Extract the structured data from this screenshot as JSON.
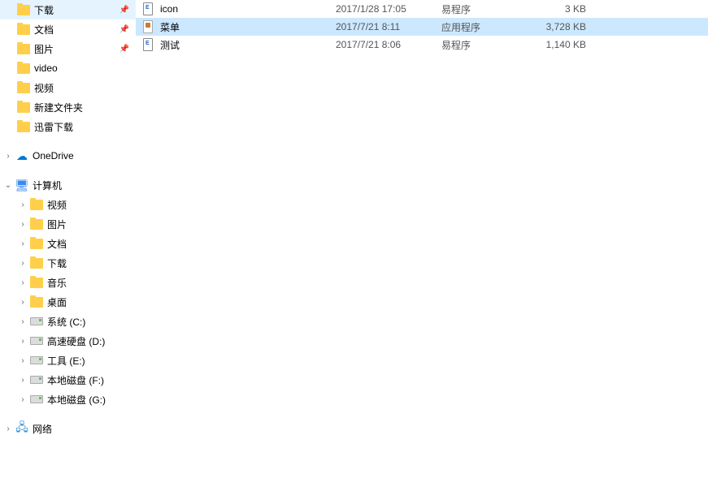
{
  "sidebar": {
    "quick": [
      {
        "label": "下载",
        "icon": "folder",
        "pinned": true
      },
      {
        "label": "文档",
        "icon": "folder",
        "pinned": true
      },
      {
        "label": "图片",
        "icon": "folder",
        "pinned": true
      },
      {
        "label": "video",
        "icon": "folder",
        "pinned": false
      },
      {
        "label": "视频",
        "icon": "folder",
        "pinned": false
      },
      {
        "label": "新建文件夹",
        "icon": "folder",
        "pinned": false
      },
      {
        "label": "迅雷下载",
        "icon": "folder",
        "pinned": false
      }
    ],
    "onedrive": {
      "label": "OneDrive",
      "chevron": ">"
    },
    "computer": {
      "label": "计算机",
      "chevron": "v",
      "items": [
        {
          "label": "视频",
          "icon": "folder"
        },
        {
          "label": "图片",
          "icon": "folder"
        },
        {
          "label": "文档",
          "icon": "folder"
        },
        {
          "label": "下载",
          "icon": "folder"
        },
        {
          "label": "音乐",
          "icon": "folder"
        },
        {
          "label": "桌面",
          "icon": "folder"
        },
        {
          "label": "系统 (C:)",
          "icon": "drive"
        },
        {
          "label": "高速硬盘 (D:)",
          "icon": "drive"
        },
        {
          "label": "工具 (E:)",
          "icon": "drive"
        },
        {
          "label": "本地磁盘 (F:)",
          "icon": "drive"
        },
        {
          "label": "本地磁盘 (G:)",
          "icon": "drive"
        }
      ]
    },
    "network": {
      "label": "网络",
      "chevron": ">"
    }
  },
  "files": [
    {
      "name": "icon",
      "date": "2017/1/28 17:05",
      "type": "易程序",
      "size": "3 KB",
      "icon": "doc",
      "selected": false
    },
    {
      "name": "菜单",
      "date": "2017/7/21 8:11",
      "type": "应用程序",
      "size": "3,728 KB",
      "icon": "exe",
      "selected": true
    },
    {
      "name": "测试",
      "date": "2017/7/21 8:06",
      "type": "易程序",
      "size": "1,140 KB",
      "icon": "doc",
      "selected": false
    }
  ]
}
